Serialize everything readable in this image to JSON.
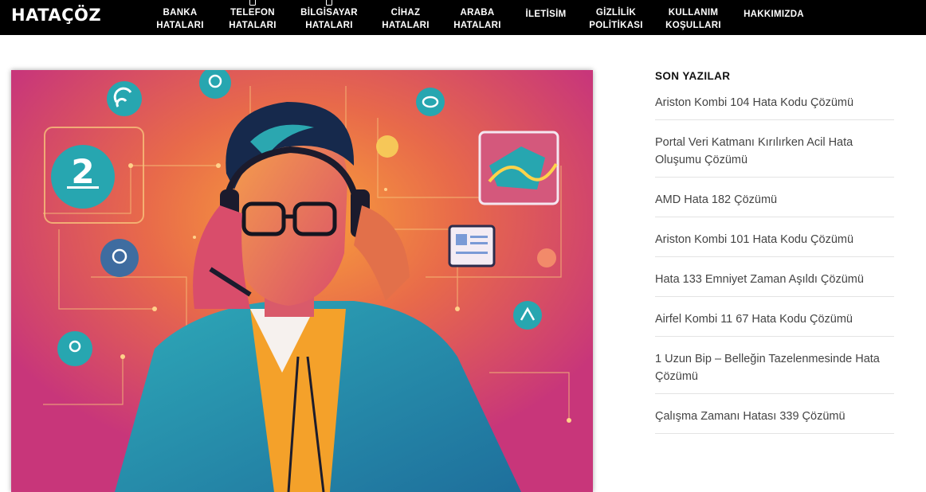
{
  "header": {
    "logo": "HATAÇÖZ",
    "nav": [
      {
        "label": "BANKA\nHATALARI"
      },
      {
        "label": "TELEFON\nHATALARI"
      },
      {
        "label": "BİLGİSAYAR\nHATALARI"
      },
      {
        "label": "CİHAZ\nHATALARI"
      },
      {
        "label": "ARABA\nHATALARI"
      },
      {
        "label": "İLETİSİM"
      },
      {
        "label": "GİZLİLİK\nPOLİTİKASI"
      },
      {
        "label": "KULLANIM\nKOŞULLARI"
      },
      {
        "label": "HAKKIMIZDA"
      }
    ]
  },
  "hero": {
    "badge_number": "2",
    "colors": {
      "background": "#c8367a",
      "accent_orange": "#f59a2c",
      "accent_teal": "#27a6b0",
      "suit": "#2e9ab0"
    }
  },
  "sidebar": {
    "title": "SON YAZILAR",
    "posts": [
      {
        "title": "Ariston Kombi 104 Hata Kodu Çözümü"
      },
      {
        "title": "Portal Veri Katmanı Kırılırken Acil Hata Oluşumu Çözümü"
      },
      {
        "title": "AMD Hata 182 Çözümü"
      },
      {
        "title": "Ariston Kombi 101 Hata Kodu Çözümü"
      },
      {
        "title": "Hata 133 Emniyet Zaman Aşıldı Çözümü"
      },
      {
        "title": "Airfel Kombi 11 67 Hata Kodu Çözümü"
      },
      {
        "title": "1 Uzun Bip – Belleğin Tazelenmesinde Hata Çözümü"
      },
      {
        "title": "Çalışma Zamanı Hatası 339 Çözümü"
      }
    ]
  }
}
